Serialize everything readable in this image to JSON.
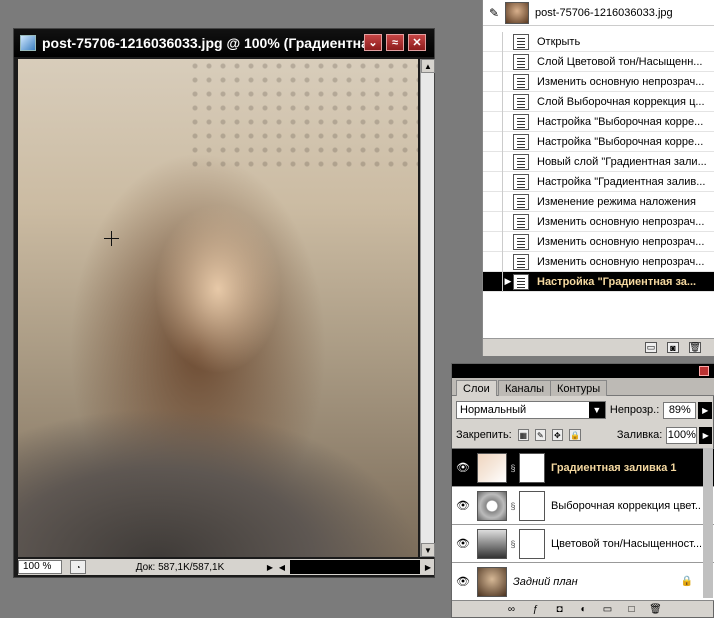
{
  "document": {
    "title": "post-75706-1216036033.jpg @ 100% (Градиентна",
    "zoom": "100 %",
    "doc_info": "Док: 587,1K/587,1K",
    "buttons": {
      "minimize": "⌄",
      "maximize": "≈",
      "close": "✕"
    }
  },
  "history": {
    "snapshot_label": "post-75706-1216036033.jpg",
    "items": [
      "Открыть",
      "Слой Цветовой тон/Насыщенн...",
      "Изменить основную непрозрач...",
      "Слой Выборочная коррекция ц...",
      "Настройка \"Выборочная корре...",
      "Настройка \"Выборочная корре...",
      "Новый слой \"Градиентная зали...",
      "Настройка \"Градиентная залив...",
      "Изменение режима наложения",
      "Изменить основную непрозрач...",
      "Изменить основную непрозрач...",
      "Изменить основную непрозрач...",
      "Настройка \"Градиентная за..."
    ],
    "active_index": 12
  },
  "layers_panel": {
    "tabs": [
      "Слои",
      "Каналы",
      "Контуры"
    ],
    "active_tab": 0,
    "blend_mode": "Нормальный",
    "opacity_label": "Непрозр.:",
    "opacity_value": "89%",
    "lock_label": "Закрепить:",
    "fill_label": "Заливка:",
    "fill_value": "100%",
    "layers": [
      {
        "name": "Градиентная заливка 1",
        "thumb": "gradient",
        "active": true
      },
      {
        "name": "Выборочная коррекция цвет...",
        "thumb": "selective",
        "active": false
      },
      {
        "name": "Цветовой тон/Насыщенност...",
        "thumb": "hue",
        "active": false
      },
      {
        "name": "Задний план",
        "thumb": "background",
        "active": false,
        "locked": true
      }
    ]
  }
}
